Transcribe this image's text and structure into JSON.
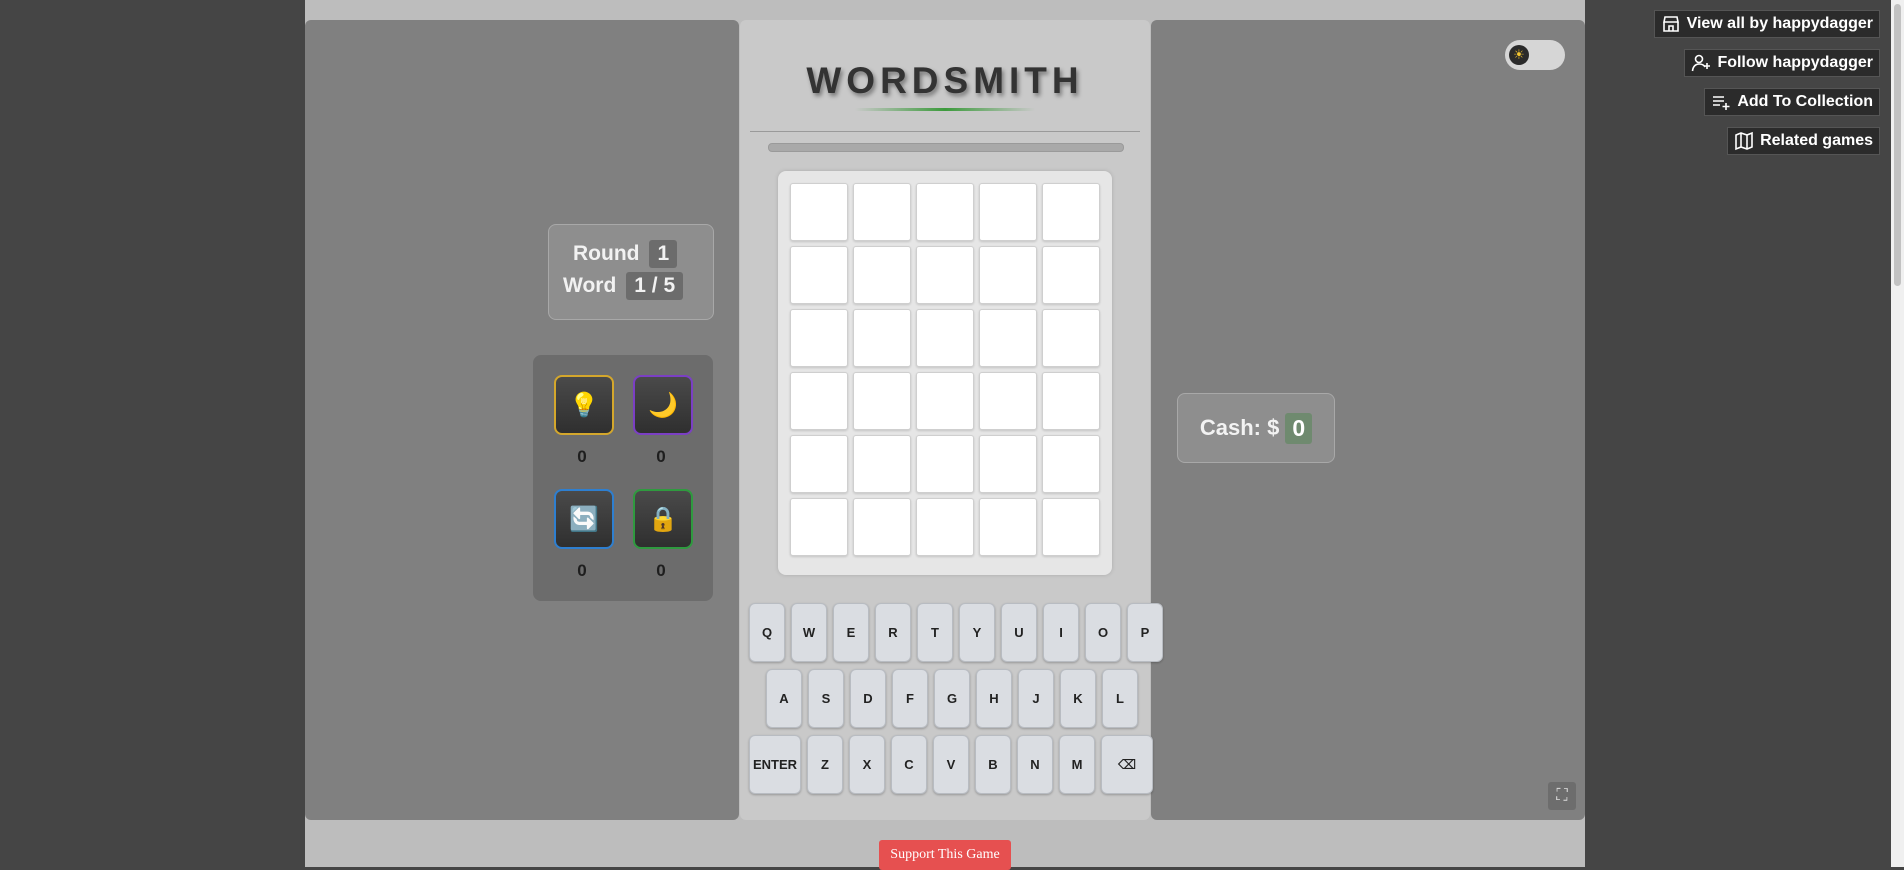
{
  "game": {
    "title": "WORDSMITH",
    "progress": 0,
    "round_label": "Round",
    "round_value": "1",
    "word_label": "Word",
    "word_value": "1 / 5",
    "cash_label": "Cash: $",
    "cash_value": "0"
  },
  "board": {
    "rows": 6,
    "cols": 5,
    "letters": [
      [
        "",
        "",
        "",
        "",
        ""
      ],
      [
        "",
        "",
        "",
        "",
        ""
      ],
      [
        "",
        "",
        "",
        "",
        ""
      ],
      [
        "",
        "",
        "",
        "",
        ""
      ],
      [
        "",
        "",
        "",
        "",
        ""
      ],
      [
        "",
        "",
        "",
        "",
        ""
      ]
    ]
  },
  "keyboard": {
    "row1": [
      "Q",
      "W",
      "E",
      "R",
      "T",
      "Y",
      "U",
      "I",
      "O",
      "P"
    ],
    "row2": [
      "A",
      "S",
      "D",
      "F",
      "G",
      "H",
      "J",
      "K",
      "L"
    ],
    "row3": [
      "ENTER",
      "Z",
      "X",
      "C",
      "V",
      "B",
      "N",
      "M",
      "⌫"
    ]
  },
  "powerups": [
    {
      "icon": "lightbulb-icon",
      "glyph": "💡",
      "count": "0",
      "border": "#d4a72c"
    },
    {
      "icon": "moon-icon",
      "glyph": "🌙",
      "count": "0",
      "border": "#7b3fc4"
    },
    {
      "icon": "refresh-icon",
      "glyph": "🔄",
      "count": "0",
      "border": "#2e7fd0"
    },
    {
      "icon": "lock-icon",
      "glyph": "🔒",
      "count": "0",
      "border": "#2f9a3f"
    }
  ],
  "theme_toggle": {
    "icon": "sun-icon",
    "glyph": "☀"
  },
  "itch": {
    "view_all": "View all by happydagger",
    "follow": "Follow happydagger",
    "add_collection": "Add To Collection",
    "related": "Related games"
  },
  "support_label": "Support This Game",
  "fullscreen_glyph": "⛶",
  "colors": {
    "accent_green": "#3c9a3c",
    "support_red": "#e65050"
  }
}
